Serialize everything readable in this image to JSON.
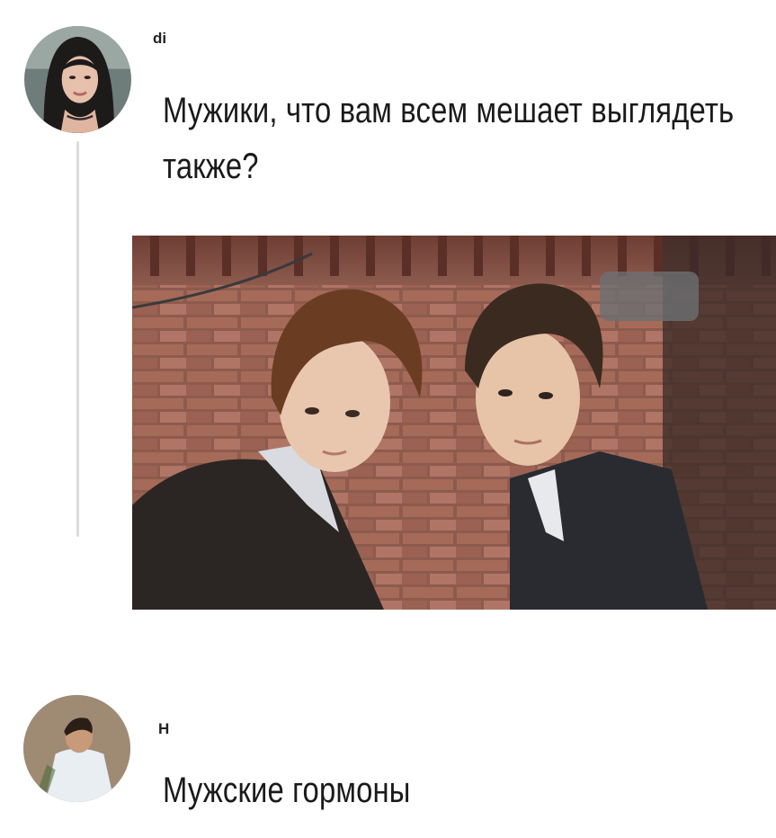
{
  "posts": [
    {
      "username": "dі",
      "text": "Мужики, что вам всем мешает выглядеть также?",
      "avatar_icon": "user-avatar-woman"
    },
    {
      "username": "Н",
      "text": "Мужские гормоны",
      "avatar_icon": "user-avatar-man"
    }
  ],
  "colors": {
    "background": "#ffffff",
    "thread_line": "#dcdcdc",
    "text": "#1a1a1a"
  }
}
